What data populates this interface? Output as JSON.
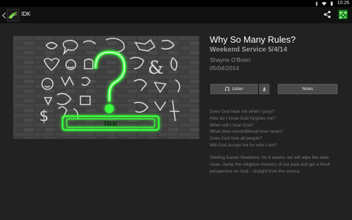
{
  "status_bar": {
    "time": "10:26",
    "icons": [
      "bluetooth-icon",
      "wifi-icon",
      "battery-icon"
    ]
  },
  "action_bar": {
    "title": "IDK",
    "icons": [
      "back-icon",
      "app-logo",
      "share-icon",
      "qr-code-icon"
    ]
  },
  "sermon": {
    "title": "Why So Many Rules?",
    "series": "Weekend Service 5/4/14",
    "speaker": "Shayne O'Brien",
    "date": "05/04/2014",
    "artwork_text": "IDK"
  },
  "buttons": {
    "listen_label": "Listen",
    "notes_label": "Notes"
  },
  "questions": [
    "Does God hear me when I pray?",
    "How do I know God forgives me?",
    "When will I hear God?",
    "What does unconditional love mean?",
    "Does God love all people?",
    "Will God accept me for who I am?"
  ],
  "description": "Starting Easter Weekend, for 6 weeks, we will wipe the slate clean, dump the religious memory of our past and get a fresh perspective on God - straight from the source.",
  "colors": {
    "background": "#222222",
    "action_bar": "#111111",
    "neon_green": "#39ff3a",
    "button": "#4a4a4a"
  }
}
